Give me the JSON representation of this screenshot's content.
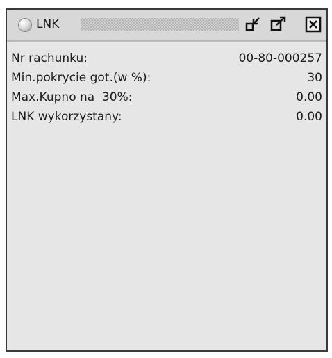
{
  "window": {
    "title": "LNK",
    "icons": {
      "status": "status-led-icon",
      "restore": "restore-window-icon",
      "maximize": "maximize-window-icon",
      "close": "close-icon"
    }
  },
  "rows": [
    {
      "label": "Nr rachunku:",
      "value": "00-80-000257"
    },
    {
      "label": "Min.pokrycie got.(w %):",
      "value": "30"
    },
    {
      "label": "Max.Kupno na  30%:",
      "value": "0.00"
    },
    {
      "label": "LNK wykorzystany:",
      "value": "0.00"
    }
  ],
  "colors": {
    "window_bg": "#e6e6e6",
    "border": "#3a3a3a",
    "titlebar_bg": "#d8d8d8",
    "text": "#1c1c1c"
  }
}
